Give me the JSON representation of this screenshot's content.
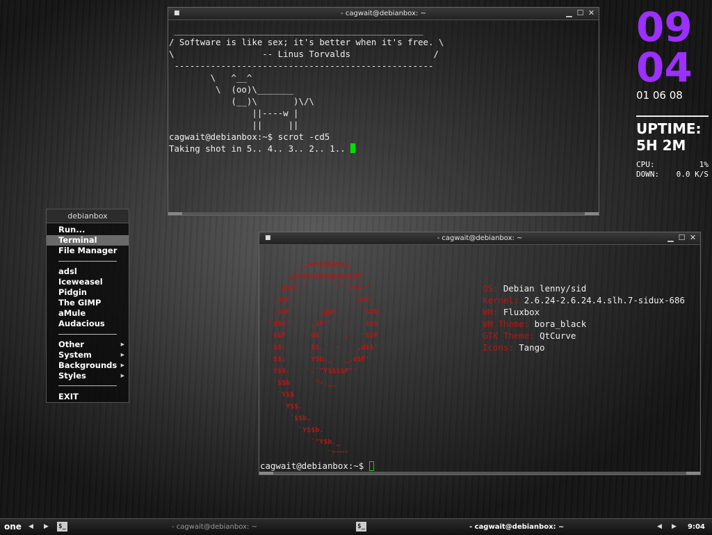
{
  "terminal1": {
    "title": "- cagwait@debianbox: ~",
    "lines": [
      " ________________________________________________",
      "/ Software is like sex; it's better when it's free. \\",
      "\\                 -- Linus Torvalds                /",
      " --------------------------------------------------",
      "        \\   ^__^",
      "         \\  (oo)\\_______",
      "            (__)\\       )\\/\\",
      "                ||----w |",
      "                ||     ||",
      "cagwait@debianbox:~$ scrot -cd5",
      "Taking shot in 5.. 4.. 3.. 2.. 1.. "
    ]
  },
  "terminal2": {
    "title": "- cagwait@debianbox: ~",
    "logo_color": "#b01818",
    "label_color": "#b01818",
    "logo_lines": [
      "         _,met$$$$$gg.",
      "      ,g$$$$$$$$$$$$$$$P.",
      "    ,g$$P\"\"       \"\"\"Y$$.\".",
      "   ,$$P'              `$$$.",
      "  ',$$P       ,ggs.     `$$b:",
      "  `d$$'     ,$P\"'   .    $$$",
      "   $$P      d$'     ,    $$P",
      "   $$:      $$.   -    ,d$$'",
      "   $$;      Y$b._   _,d$P'",
      "   Y$$.    `.`\"Y$$$$P\"'",
      "   `$$b      \"-.__",
      "    `Y$$",
      "     `Y$$.",
      "       `$$b.",
      "         `Y$$b.",
      "            `\"Y$b._",
      "                `\"\"\"\""
    ],
    "info": [
      {
        "label": "OS:",
        "value": "Debian lenny/sid"
      },
      {
        "label": "Kernel:",
        "value": "2.6.24-2.6.24.4.slh.7-sidux-686"
      },
      {
        "label": "WM:",
        "value": "Fluxbox"
      },
      {
        "label": "WM Theme:",
        "value": "bora_black"
      },
      {
        "label": "GTK Theme:",
        "value": "QtCurve"
      },
      {
        "label": "Icons:",
        "value": "Tango"
      }
    ],
    "prompt": "cagwait@debianbox:~$ "
  },
  "menu": {
    "title": "debianbox",
    "items": [
      "Run...",
      "Terminal",
      "File Manager",
      "adsl",
      "Iceweasel",
      "Pidgin",
      "The GIMP",
      "aMule",
      "Audacious",
      "Other",
      "System",
      "Backgrounds",
      "Styles",
      "EXIT"
    ]
  },
  "conky": {
    "hour": "09",
    "minute": "04",
    "date": "01 06 08",
    "uptime_label": "UPTIME:",
    "uptime_value": "5H 2M",
    "cpu_label": "CPU:",
    "cpu_value": "1%",
    "down_label": "DOWN:",
    "down_value": "0.0 K/S",
    "clock_color": "#9b30ff"
  },
  "taskbar": {
    "workspace": "one",
    "task1": "- cagwait@debianbox: ~",
    "task2": "- cagwait@debianbox: ~",
    "clock": "9:04"
  }
}
